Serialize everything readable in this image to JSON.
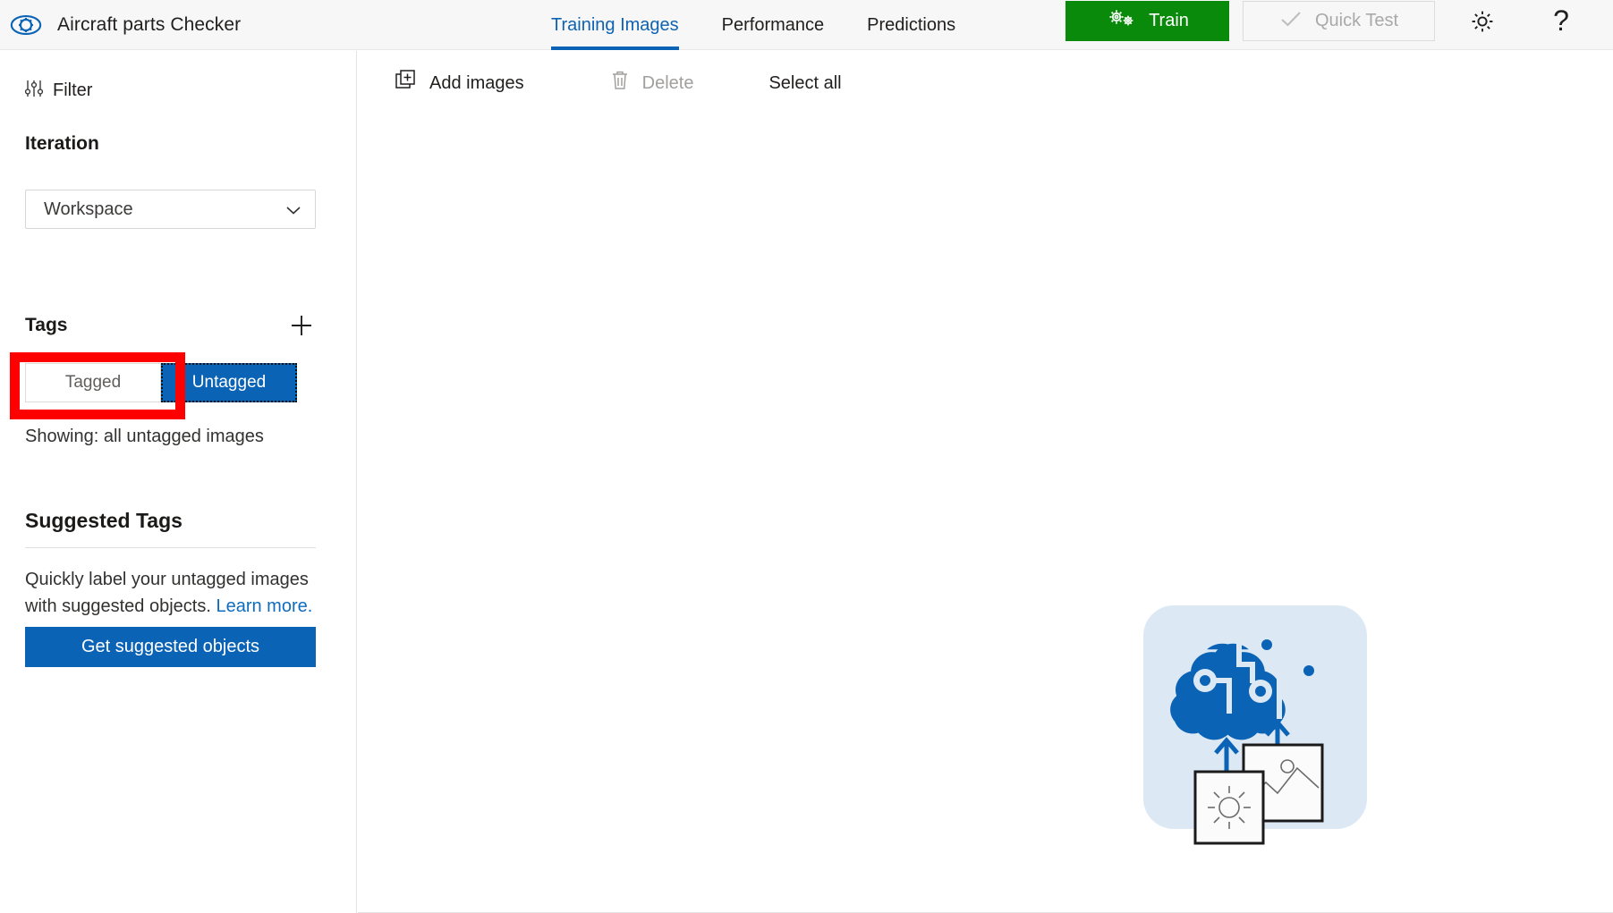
{
  "header": {
    "logo_icon": "eye-gear-logo-icon",
    "project_title": "Aircraft parts Checker",
    "tabs": [
      {
        "label": "Training Images",
        "active": true
      },
      {
        "label": "Performance",
        "active": false
      },
      {
        "label": "Predictions",
        "active": false
      }
    ],
    "train_button": {
      "label": "Train",
      "icon": "gears-icon",
      "color": "#0a8a0a",
      "enabled": true
    },
    "quick_test_button": {
      "label": "Quick Test",
      "icon": "check-icon",
      "enabled": false
    },
    "settings_icon": "gear-icon",
    "help_icon": "question-mark-icon",
    "accent_color": "#0b63b5"
  },
  "sidebar": {
    "filter": {
      "label": "Filter",
      "icon": "sliders-icon"
    },
    "iteration": {
      "heading": "Iteration",
      "selected": "Workspace",
      "options": [
        "Workspace"
      ],
      "chevron_icon": "chevron-down-icon"
    },
    "tags": {
      "heading": "Tags",
      "add_icon": "plus-icon",
      "tagged_label": "Tagged",
      "untagged_label": "Untagged",
      "selected": "Untagged",
      "showing_text": "Showing: all untagged images"
    },
    "suggested_tags": {
      "heading": "Suggested Tags",
      "description": "Quickly label your untagged images with suggested objects.",
      "learn_more_label": "Learn more.",
      "button_label": "Get suggested objects"
    }
  },
  "main": {
    "toolbar": {
      "add_images_label": "Add images",
      "add_images_icon": "add-image-icon",
      "delete_label": "Delete",
      "delete_icon": "trash-icon",
      "delete_enabled": false,
      "select_all_label": "Select all"
    },
    "empty_state": {
      "illustration": "brain-cloud-upload-images-illustration",
      "brain_color": "#0b63b5",
      "panel_color": "#dce9f5"
    }
  },
  "annotation": {
    "highlight_box": {
      "color": "#ff0000",
      "target": "Tagged"
    }
  }
}
